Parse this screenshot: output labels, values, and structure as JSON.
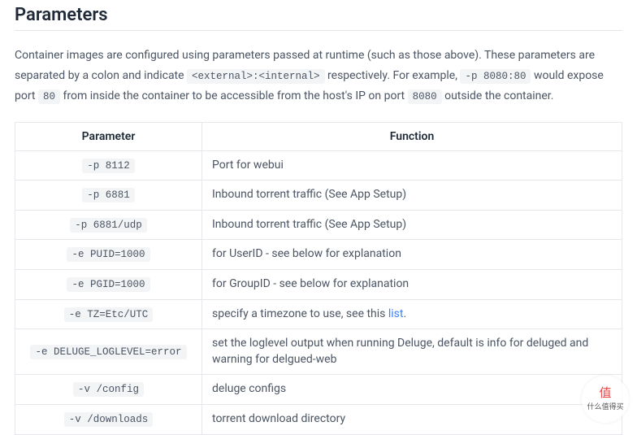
{
  "heading": "Parameters",
  "intro": {
    "part1": "Container images are configured using parameters passed at runtime (such as those above). These parameters are separated by a colon and indicate ",
    "code1": "<external>:<internal>",
    "part2": " respectively. For example, ",
    "code2": "-p 8080:80",
    "part3": " would expose port ",
    "code3": "80",
    "part4": " from inside the container to be accessible from the host's IP on port ",
    "code4": "8080",
    "part5": " outside the container."
  },
  "table": {
    "headers": {
      "param": "Parameter",
      "func": "Function"
    },
    "rows": [
      {
        "param": "-p 8112",
        "func": "Port for webui"
      },
      {
        "param": "-p 6881",
        "func": "Inbound torrent traffic (See App Setup)"
      },
      {
        "param": "-p 6881/udp",
        "func": "Inbound torrent traffic (See App Setup)"
      },
      {
        "param": "-e PUID=1000",
        "func": "for UserID - see below for explanation"
      },
      {
        "param": "-e PGID=1000",
        "func": "for GroupID - see below for explanation"
      },
      {
        "param": "-e TZ=Etc/UTC",
        "func_pre": "specify a timezone to use, see this ",
        "func_link": "list",
        "func_post": "."
      },
      {
        "param": "-e DELUGE_LOGLEVEL=error",
        "func": "set the loglevel output when running Deluge, default is info for deluged and warning for delgued-web"
      },
      {
        "param": "-v /config",
        "func": "deluge configs"
      },
      {
        "param": "-v /downloads",
        "func": "torrent download directory"
      }
    ]
  },
  "watermark": {
    "icon": "值",
    "text": "什么值得买"
  }
}
